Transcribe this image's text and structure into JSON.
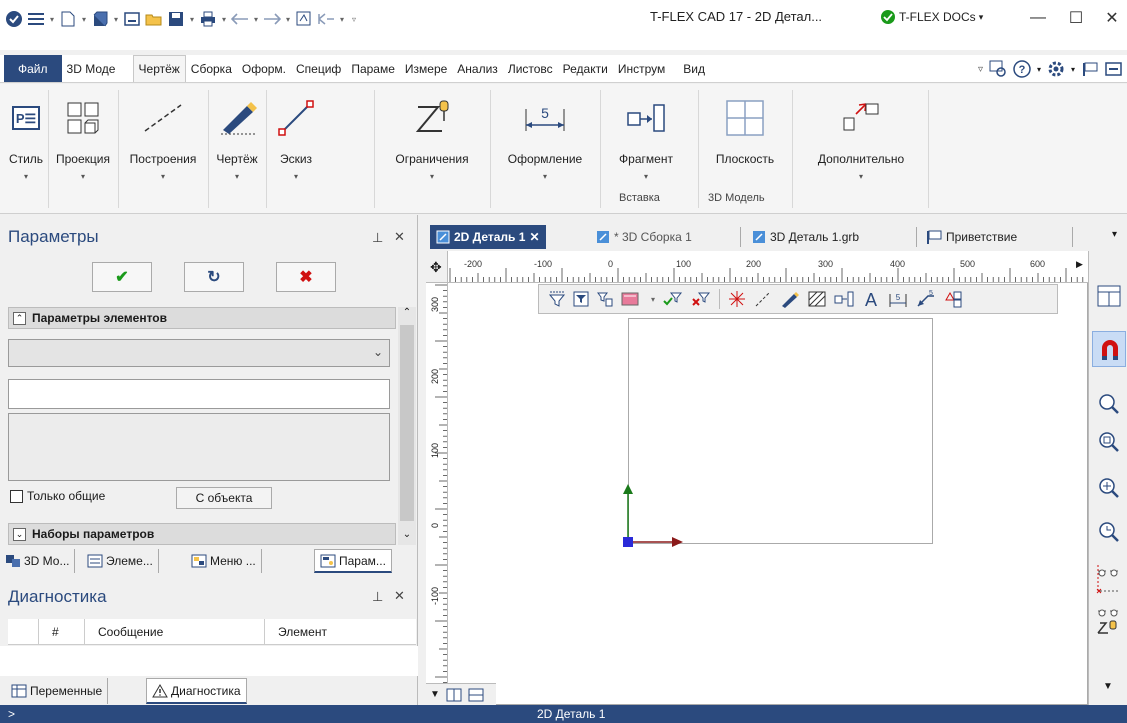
{
  "window": {
    "title": "T-FLEX CAD 17 - 2D Детал...",
    "docs_label": "T-FLEX DOCs",
    "minimize": "—",
    "maximize": "☐",
    "close": "✕"
  },
  "menu": {
    "file": "Файл",
    "tabs": [
      "3D Моде",
      "Чертёж",
      "Сборка",
      "Оформ.",
      "Специф",
      "Параме",
      "Измере",
      "Анализ",
      "Листовс",
      "Редакти",
      "Инструм"
    ],
    "active_index": 1,
    "view": "Вид"
  },
  "ribbon": {
    "buttons": [
      "Стиль",
      "Проекция",
      "Построения",
      "Чертёж",
      "Эскиз",
      "Ограничения",
      "Оформление",
      "Фрагмент",
      "Плоскость",
      "Дополнительно"
    ],
    "groups": [
      "Вставка",
      "3D Модель"
    ]
  },
  "params_panel": {
    "title": "Параметры",
    "ok_glyph": "✔",
    "refresh_glyph": "↻",
    "cancel_glyph": "✖",
    "section_elements": "Параметры элементов",
    "only_common": "Только общие",
    "from_object": "С объекта",
    "section_sets": "Наборы параметров",
    "tabs": [
      "3D Мо...",
      "Элеме...",
      "Меню ...",
      "Парам..."
    ]
  },
  "diag_panel": {
    "title": "Диагностика",
    "columns": [
      "#",
      "Сообщение",
      "Элемент"
    ],
    "tabs": [
      "Переменные",
      "Диагностика"
    ]
  },
  "doc_tabs": [
    "2D Деталь 1",
    "* 3D Сборка 1",
    "3D Деталь 1.grb",
    "Приветствие"
  ],
  "ruler": {
    "h_labels": [
      "-200",
      "-100",
      "0",
      "100",
      "200",
      "300",
      "400",
      "500",
      "600"
    ],
    "v_labels": [
      "300",
      "200",
      "100",
      "0",
      "-100"
    ]
  },
  "status": {
    "prompt": ">",
    "doc": "2D Деталь 1"
  },
  "colors": {
    "accent": "#2b4a7e",
    "ok": "#1a9a1a",
    "cancel": "#d01010"
  }
}
